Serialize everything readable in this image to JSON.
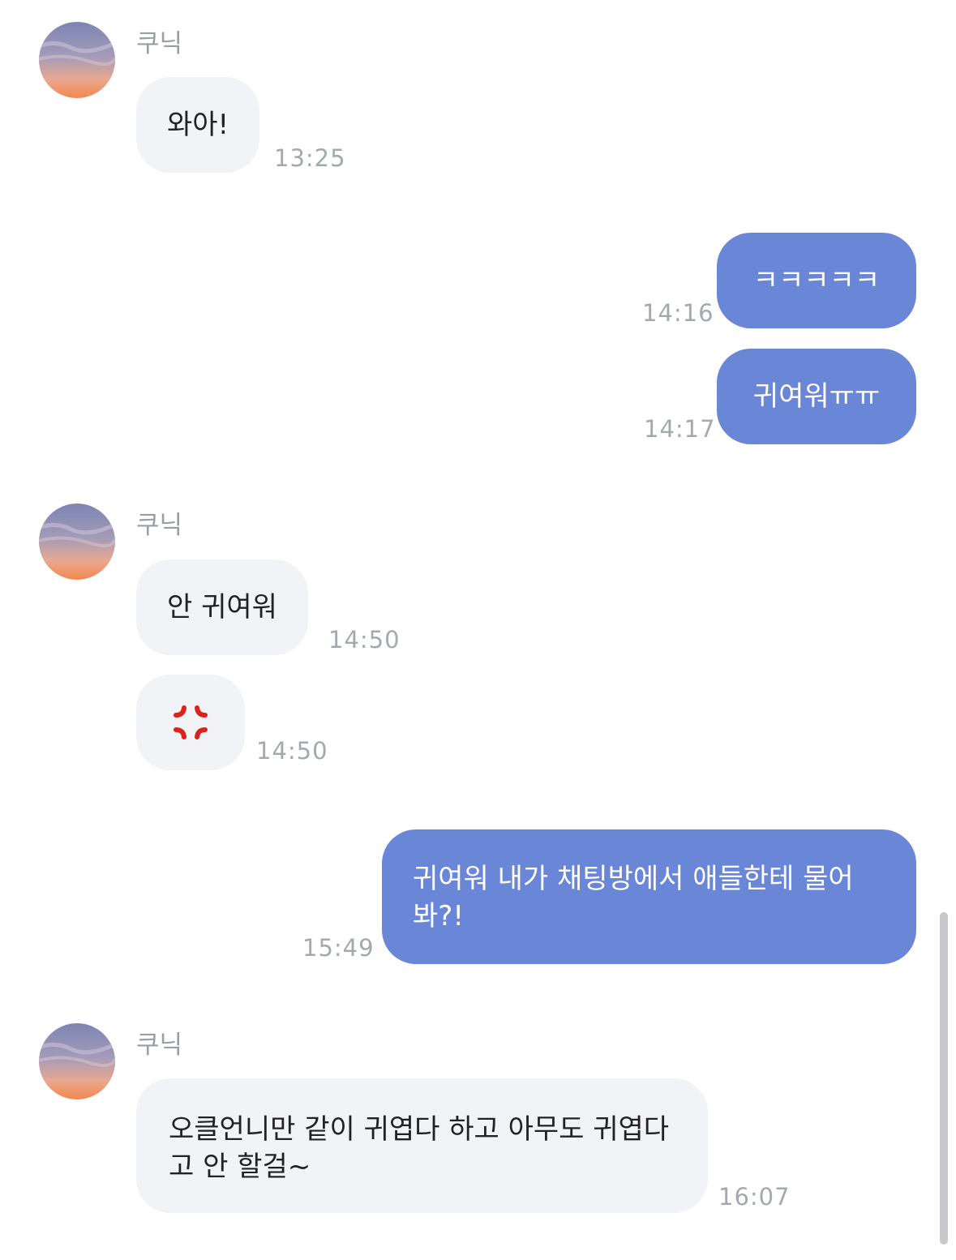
{
  "contact": {
    "name": "쿠닉"
  },
  "messages": [
    {
      "direction": "in",
      "text": "와아!",
      "time": "13:25"
    },
    {
      "direction": "out",
      "text": "ㅋㅋㅋㅋㅋ",
      "time": "14:16"
    },
    {
      "direction": "out",
      "text": "귀여워ㅠㅠ",
      "time": "14:17"
    },
    {
      "direction": "in",
      "text": "안 귀여워",
      "time": "14:50"
    },
    {
      "direction": "in",
      "emoji": "anger-symbol-icon",
      "time": "14:50"
    },
    {
      "direction": "out",
      "text": "귀여워 내가 채팅방에서 애들한테 물어봐?!",
      "time": "15:49"
    },
    {
      "direction": "in",
      "text": "오클언니만 같이 귀엽다 하고 아무도 귀엽다고 안 할걸~",
      "time": "16:07"
    }
  ],
  "colors": {
    "outgoing_bubble": "#6a86d7",
    "incoming_bubble": "#f2f3f7",
    "timestamp": "#a4a8b0",
    "sender_name": "#9a9ea6",
    "anger_icon": "#e0211b"
  }
}
